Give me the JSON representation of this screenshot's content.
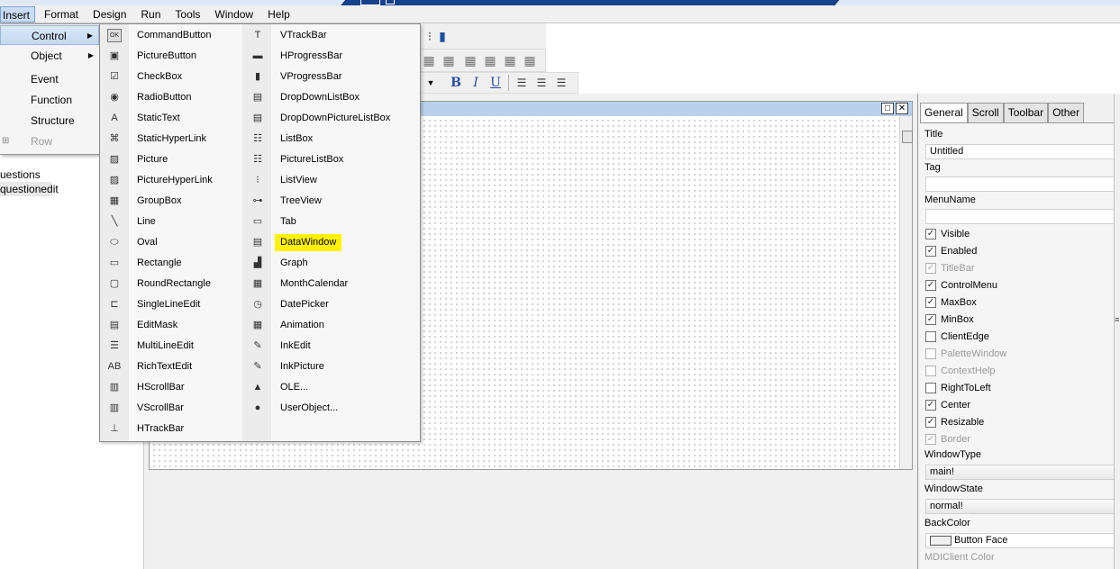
{
  "menubar": {
    "items": [
      "Insert",
      "Format",
      "Design",
      "Run",
      "Tools",
      "Window",
      "Help"
    ]
  },
  "insert_menu": {
    "items": [
      {
        "label": "Control",
        "submenu": true
      },
      {
        "label": "Object",
        "submenu": true
      },
      {
        "label": "Event"
      },
      {
        "label": "Function"
      },
      {
        "label": "Structure"
      },
      {
        "label": "Row",
        "disabled": true
      }
    ]
  },
  "left_tree": {
    "items": [
      "uestions",
      "questionedit"
    ]
  },
  "control_menu": {
    "col1": [
      {
        "label": "CommandButton",
        "icon": "command-button-icon",
        "glyph": "OK"
      },
      {
        "label": "PictureButton",
        "icon": "picture-button-icon",
        "glyph": "▣"
      },
      {
        "label": "CheckBox",
        "icon": "checkbox-icon",
        "glyph": "☑"
      },
      {
        "label": "RadioButton",
        "icon": "radio-button-icon",
        "glyph": "◉"
      },
      {
        "label": "StaticText",
        "icon": "static-text-icon",
        "glyph": "A"
      },
      {
        "label": "StaticHyperLink",
        "icon": "static-hyperlink-icon",
        "glyph": "⌘"
      },
      {
        "label": "Picture",
        "icon": "picture-icon",
        "glyph": "▨"
      },
      {
        "label": "PictureHyperLink",
        "icon": "picture-hyperlink-icon",
        "glyph": "▨"
      },
      {
        "label": "GroupBox",
        "icon": "groupbox-icon",
        "glyph": "▦"
      },
      {
        "label": "Line",
        "icon": "line-icon",
        "glyph": "╲"
      },
      {
        "label": "Oval",
        "icon": "oval-icon",
        "glyph": "⬭"
      },
      {
        "label": "Rectangle",
        "icon": "rectangle-icon",
        "glyph": "▭"
      },
      {
        "label": "RoundRectangle",
        "icon": "round-rectangle-icon",
        "glyph": "▢"
      },
      {
        "label": "SingleLineEdit",
        "icon": "single-line-edit-icon",
        "glyph": "⊏"
      },
      {
        "label": "EditMask",
        "icon": "edit-mask-icon",
        "glyph": "▤"
      },
      {
        "label": "MultiLineEdit",
        "icon": "multi-line-edit-icon",
        "glyph": "☰"
      },
      {
        "label": "RichTextEdit",
        "icon": "rich-text-edit-icon",
        "glyph": "AB"
      },
      {
        "label": "HScrollBar",
        "icon": "hscrollbar-icon",
        "glyph": "▥"
      },
      {
        "label": "VScrollBar",
        "icon": "vscrollbar-icon",
        "glyph": "▥"
      },
      {
        "label": "HTrackBar",
        "icon": "htrackbar-icon",
        "glyph": "⊥"
      }
    ],
    "col2": [
      {
        "label": "VTrackBar",
        "icon": "vtrackbar-icon",
        "glyph": "T"
      },
      {
        "label": "HProgressBar",
        "icon": "hprogressbar-icon",
        "glyph": "▬"
      },
      {
        "label": "VProgressBar",
        "icon": "vprogressbar-icon",
        "glyph": "▮"
      },
      {
        "label": "DropDownListBox",
        "icon": "dropdown-listbox-icon",
        "glyph": "▤"
      },
      {
        "label": "DropDownPictureListBox",
        "icon": "dropdown-picture-listbox-icon",
        "glyph": "▤"
      },
      {
        "label": "ListBox",
        "icon": "listbox-icon",
        "glyph": "☷"
      },
      {
        "label": "PictureListBox",
        "icon": "picture-listbox-icon",
        "glyph": "☷"
      },
      {
        "label": "ListView",
        "icon": "listview-icon",
        "glyph": "⁝"
      },
      {
        "label": "TreeView",
        "icon": "treeview-icon",
        "glyph": "⊶"
      },
      {
        "label": "Tab",
        "icon": "tab-icon",
        "glyph": "▭"
      },
      {
        "label": "DataWindow",
        "icon": "datawindow-icon",
        "glyph": "▤",
        "highlight": true
      },
      {
        "label": "Graph",
        "icon": "graph-icon",
        "glyph": "▟"
      },
      {
        "label": "MonthCalendar",
        "icon": "month-calendar-icon",
        "glyph": "▦"
      },
      {
        "label": "DatePicker",
        "icon": "datepicker-icon",
        "glyph": "◷"
      },
      {
        "label": "Animation",
        "icon": "animation-icon",
        "glyph": "▦"
      },
      {
        "label": "InkEdit",
        "icon": "inkedit-icon",
        "glyph": "✎"
      },
      {
        "label": "InkPicture",
        "icon": "inkpicture-icon",
        "glyph": "✎"
      },
      {
        "label": "OLE...",
        "icon": "ole-icon",
        "glyph": "▲"
      },
      {
        "label": "UserObject...",
        "icon": "userobject-icon",
        "glyph": "●"
      }
    ]
  },
  "toolbar": {
    "format": {
      "bold": "B",
      "italic": "I",
      "underline": "U"
    }
  },
  "properties": {
    "tabs": [
      "General",
      "Scroll",
      "Toolbar",
      "Other"
    ],
    "title_label": "Title",
    "title_value": "Untitled",
    "tag_label": "Tag",
    "tag_value": "",
    "menuname_label": "MenuName",
    "menuname_value": "",
    "checks": [
      {
        "label": "Visible",
        "checked": true,
        "disabled": false
      },
      {
        "label": "Enabled",
        "checked": true,
        "disabled": false
      },
      {
        "label": "TitleBar",
        "checked": true,
        "disabled": true
      },
      {
        "label": "ControlMenu",
        "checked": true,
        "disabled": false
      },
      {
        "label": "MaxBox",
        "checked": true,
        "disabled": false
      },
      {
        "label": "MinBox",
        "checked": true,
        "disabled": false
      },
      {
        "label": "ClientEdge",
        "checked": false,
        "disabled": false
      },
      {
        "label": "PaletteWindow",
        "checked": false,
        "disabled": true
      },
      {
        "label": "ContextHelp",
        "checked": false,
        "disabled": true
      },
      {
        "label": "RightToLeft",
        "checked": false,
        "disabled": false
      },
      {
        "label": "Center",
        "checked": true,
        "disabled": false
      },
      {
        "label": "Resizable",
        "checked": true,
        "disabled": false
      },
      {
        "label": "Border",
        "checked": true,
        "disabled": true
      }
    ],
    "windowtype_label": "WindowType",
    "windowtype_value": "main!",
    "windowstate_label": "WindowState",
    "windowstate_value": "normal!",
    "backcolor_label": "BackColor",
    "backcolor_value": "Button Face",
    "mdiclient_label": "MDIClient Color"
  },
  "colors": {
    "highlight": "#fff200",
    "menu_hl": "#c9dcf5",
    "titlebar": "#16428b"
  }
}
